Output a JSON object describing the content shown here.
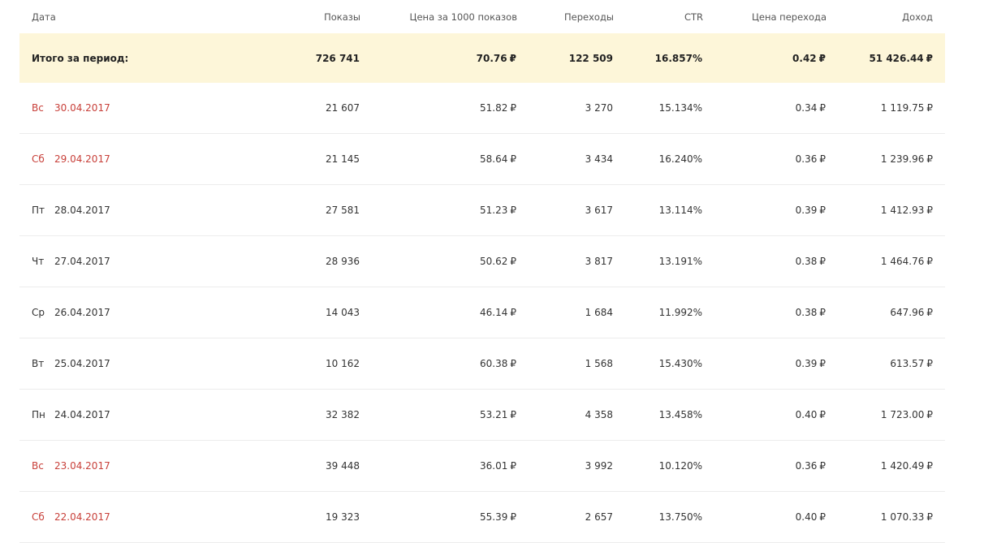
{
  "currency_symbol": "₽",
  "columns": {
    "date": "Дата",
    "impressions": "Показы",
    "cpm": "Цена за 1000 показов",
    "clicks": "Переходы",
    "ctr": "CTR",
    "cpc": "Цена перехода",
    "revenue": "Доход"
  },
  "summary": {
    "label": "Итого за период:",
    "impressions": "726 741",
    "cpm": "70.76",
    "clicks": "122 509",
    "ctr": "16.857%",
    "cpc": "0.42",
    "revenue": "51 426.44"
  },
  "rows": [
    {
      "dow": "Вс",
      "date": "30.04.2017",
      "weekend": true,
      "impressions": "21 607",
      "cpm": "51.82",
      "clicks": "3 270",
      "ctr": "15.134%",
      "cpc": "0.34",
      "revenue": "1 119.75"
    },
    {
      "dow": "Сб",
      "date": "29.04.2017",
      "weekend": true,
      "impressions": "21 145",
      "cpm": "58.64",
      "clicks": "3 434",
      "ctr": "16.240%",
      "cpc": "0.36",
      "revenue": "1 239.96"
    },
    {
      "dow": "Пт",
      "date": "28.04.2017",
      "weekend": false,
      "impressions": "27 581",
      "cpm": "51.23",
      "clicks": "3 617",
      "ctr": "13.114%",
      "cpc": "0.39",
      "revenue": "1 412.93"
    },
    {
      "dow": "Чт",
      "date": "27.04.2017",
      "weekend": false,
      "impressions": "28 936",
      "cpm": "50.62",
      "clicks": "3 817",
      "ctr": "13.191%",
      "cpc": "0.38",
      "revenue": "1 464.76"
    },
    {
      "dow": "Ср",
      "date": "26.04.2017",
      "weekend": false,
      "impressions": "14 043",
      "cpm": "46.14",
      "clicks": "1 684",
      "ctr": "11.992%",
      "cpc": "0.38",
      "revenue": "647.96"
    },
    {
      "dow": "Вт",
      "date": "25.04.2017",
      "weekend": false,
      "impressions": "10 162",
      "cpm": "60.38",
      "clicks": "1 568",
      "ctr": "15.430%",
      "cpc": "0.39",
      "revenue": "613.57"
    },
    {
      "dow": "Пн",
      "date": "24.04.2017",
      "weekend": false,
      "impressions": "32 382",
      "cpm": "53.21",
      "clicks": "4 358",
      "ctr": "13.458%",
      "cpc": "0.40",
      "revenue": "1 723.00"
    },
    {
      "dow": "Вс",
      "date": "23.04.2017",
      "weekend": true,
      "impressions": "39 448",
      "cpm": "36.01",
      "clicks": "3 992",
      "ctr": "10.120%",
      "cpc": "0.36",
      "revenue": "1 420.49"
    },
    {
      "dow": "Сб",
      "date": "22.04.2017",
      "weekend": true,
      "impressions": "19 323",
      "cpm": "55.39",
      "clicks": "2 657",
      "ctr": "13.750%",
      "cpc": "0.40",
      "revenue": "1 070.33"
    }
  ],
  "colors": {
    "summary_bg": "#fdf6d9",
    "weekend_text": "#c8403a",
    "row_border": "#ececec"
  }
}
